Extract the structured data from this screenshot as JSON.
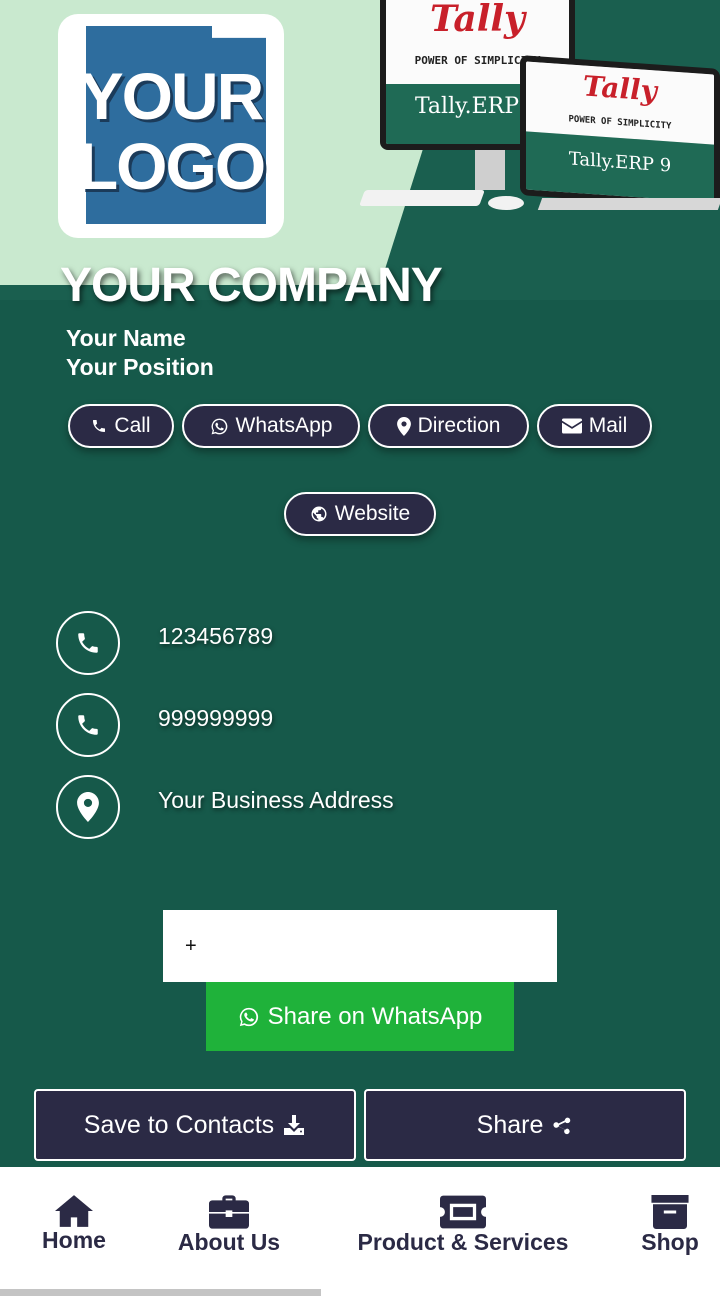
{
  "hero": {
    "logo_text_line1": "YOUR",
    "logo_text_line2": "LOGO",
    "monitor_brand": "Tally",
    "monitor_tagline": "POWER OF SIMPLICITY",
    "monitor_product": "Tally.ERP 9",
    "laptop_brand": "Tally",
    "laptop_tagline": "POWER OF SIMPLICITY",
    "laptop_product": "Tally.ERP 9"
  },
  "profile": {
    "company": "YOUR COMPANY",
    "name": "Your Name",
    "position": "Your Position"
  },
  "actions": {
    "call": "Call",
    "whatsapp": "WhatsApp",
    "direction": "Direction",
    "mail": "Mail",
    "website": "Website"
  },
  "contact_info": {
    "phone1": "123456789",
    "phone2": "999999999",
    "address": "Your Business Address"
  },
  "share_form": {
    "phone_value": "+",
    "share_whatsapp_label": "Share on WhatsApp"
  },
  "buttons": {
    "save_contacts": "Save to Contacts",
    "share": "Share"
  },
  "nav": {
    "home": "Home",
    "about": "About Us",
    "products": "Product & Services",
    "shop": "Shop"
  },
  "colors": {
    "background": "#16594a",
    "button_dark": "#2b2a45",
    "whatsapp_green": "#1fb23a",
    "hero_light": "#c9e9cf"
  }
}
